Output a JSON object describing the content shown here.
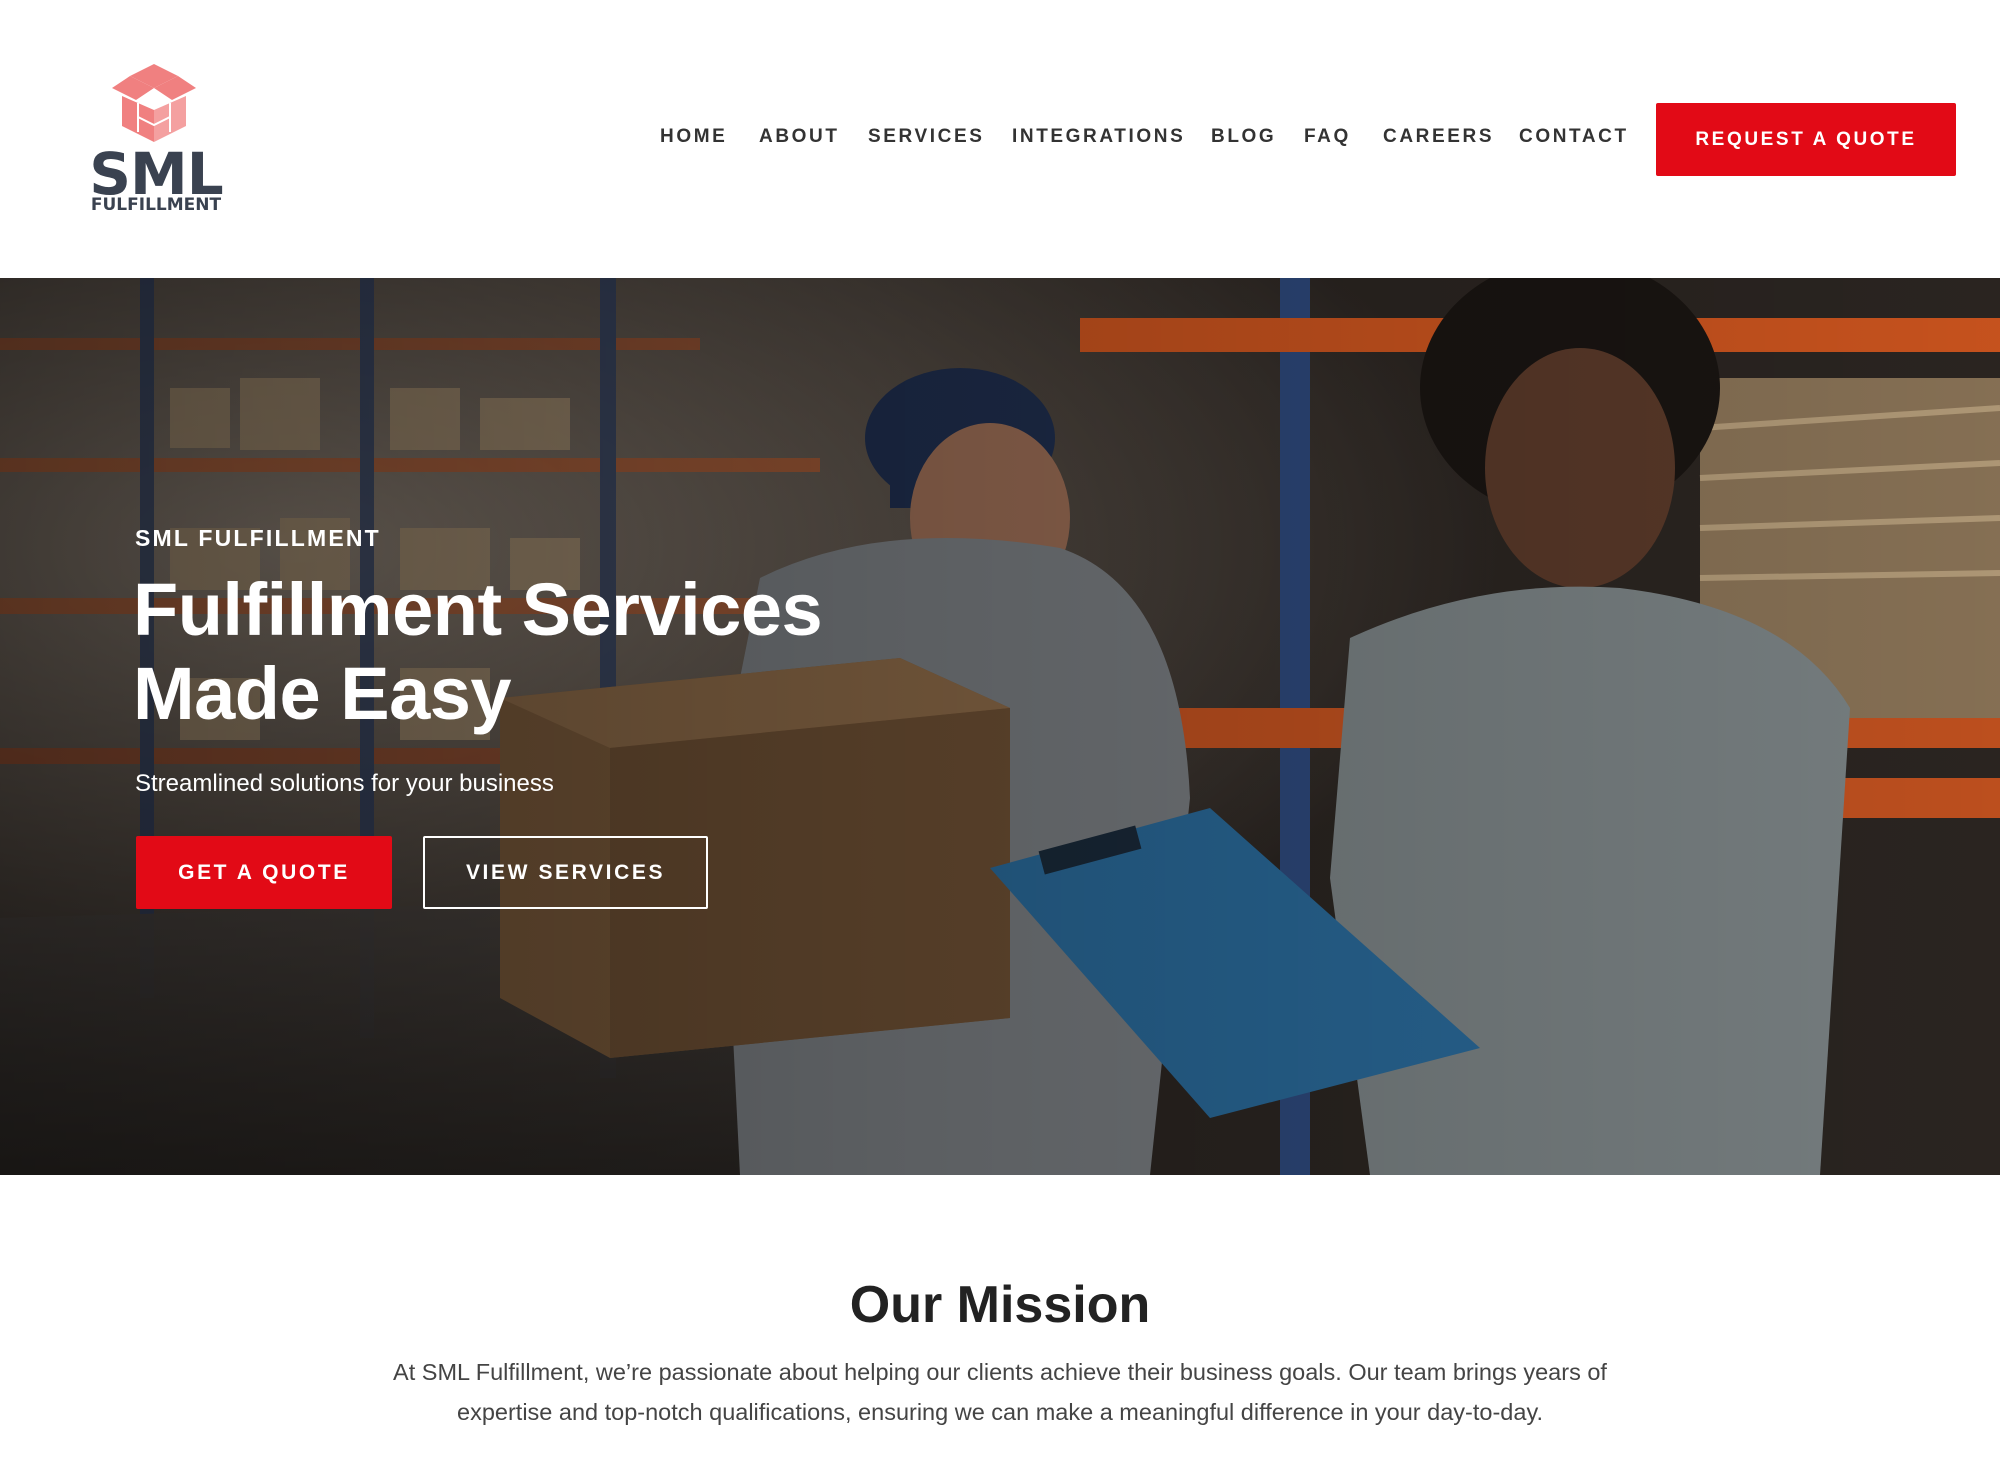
{
  "brand": {
    "name": "SML",
    "tagline": "FULFILLMENT",
    "logo_icon": "open-box-icon",
    "logo_color": "#f08080",
    "text_color": "#3a4250"
  },
  "nav": {
    "items": [
      {
        "label": "HOME"
      },
      {
        "label": "ABOUT"
      },
      {
        "label": "SERVICES"
      },
      {
        "label": "INTEGRATIONS"
      },
      {
        "label": "BLOG"
      },
      {
        "label": "FAQ"
      },
      {
        "label": "CAREERS"
      },
      {
        "label": "CONTACT"
      }
    ],
    "cta_label": "REQUEST A QUOTE"
  },
  "hero": {
    "eyebrow": "SML FULFILLMENT",
    "title_line1": "Fulfillment Services",
    "title_line2": "Made Easy",
    "subtitle": "Streamlined solutions for your business",
    "primary_button": "GET A QUOTE",
    "secondary_button": "VIEW SERVICES"
  },
  "mission": {
    "title": "Our Mission",
    "body": "At SML Fulfillment, we’re passionate about helping our clients achieve their business goals. Our team brings years of expertise and top-notch qualifications, ensuring we can make a meaningful difference in your day-to-day."
  },
  "colors": {
    "accent": "#e20a16",
    "heading": "#222222",
    "body_text": "#444444"
  }
}
